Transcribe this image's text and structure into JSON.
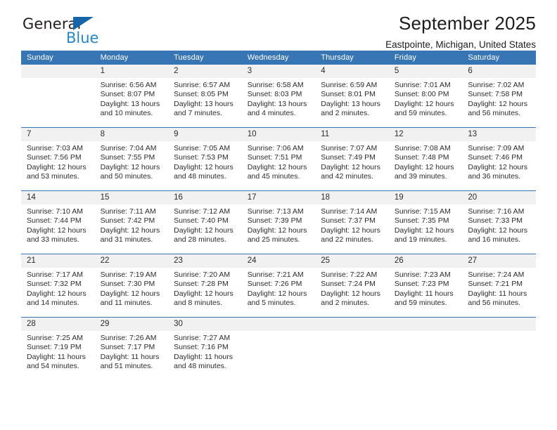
{
  "brand": {
    "name_top": "General",
    "name_bottom": "Blue",
    "triangle_color": "#1565a8",
    "blue_text_color": "#2487cb"
  },
  "header": {
    "title": "September 2025",
    "subtitle": "Eastpointe, Michigan, United States"
  },
  "theme": {
    "header_row_bg": "#3875b5",
    "header_row_text": "#ffffff",
    "daynum_bg": "#f1f1f1",
    "week_divider": "#3875b5",
    "body_text": "#2b2b2b"
  },
  "calendar": {
    "weekday_headers": [
      "Sunday",
      "Monday",
      "Tuesday",
      "Wednesday",
      "Thursday",
      "Friday",
      "Saturday"
    ],
    "weeks": [
      [
        {
          "day": "",
          "sunrise": "",
          "sunset": "",
          "daylight": "",
          "empty": true
        },
        {
          "day": "1",
          "sunrise": "Sunrise: 6:56 AM",
          "sunset": "Sunset: 8:07 PM",
          "daylight": "Daylight: 13 hours and 10 minutes."
        },
        {
          "day": "2",
          "sunrise": "Sunrise: 6:57 AM",
          "sunset": "Sunset: 8:05 PM",
          "daylight": "Daylight: 13 hours and 7 minutes."
        },
        {
          "day": "3",
          "sunrise": "Sunrise: 6:58 AM",
          "sunset": "Sunset: 8:03 PM",
          "daylight": "Daylight: 13 hours and 4 minutes."
        },
        {
          "day": "4",
          "sunrise": "Sunrise: 6:59 AM",
          "sunset": "Sunset: 8:01 PM",
          "daylight": "Daylight: 13 hours and 2 minutes."
        },
        {
          "day": "5",
          "sunrise": "Sunrise: 7:01 AM",
          "sunset": "Sunset: 8:00 PM",
          "daylight": "Daylight: 12 hours and 59 minutes."
        },
        {
          "day": "6",
          "sunrise": "Sunrise: 7:02 AM",
          "sunset": "Sunset: 7:58 PM",
          "daylight": "Daylight: 12 hours and 56 minutes."
        }
      ],
      [
        {
          "day": "7",
          "sunrise": "Sunrise: 7:03 AM",
          "sunset": "Sunset: 7:56 PM",
          "daylight": "Daylight: 12 hours and 53 minutes."
        },
        {
          "day": "8",
          "sunrise": "Sunrise: 7:04 AM",
          "sunset": "Sunset: 7:55 PM",
          "daylight": "Daylight: 12 hours and 50 minutes."
        },
        {
          "day": "9",
          "sunrise": "Sunrise: 7:05 AM",
          "sunset": "Sunset: 7:53 PM",
          "daylight": "Daylight: 12 hours and 48 minutes."
        },
        {
          "day": "10",
          "sunrise": "Sunrise: 7:06 AM",
          "sunset": "Sunset: 7:51 PM",
          "daylight": "Daylight: 12 hours and 45 minutes."
        },
        {
          "day": "11",
          "sunrise": "Sunrise: 7:07 AM",
          "sunset": "Sunset: 7:49 PM",
          "daylight": "Daylight: 12 hours and 42 minutes."
        },
        {
          "day": "12",
          "sunrise": "Sunrise: 7:08 AM",
          "sunset": "Sunset: 7:48 PM",
          "daylight": "Daylight: 12 hours and 39 minutes."
        },
        {
          "day": "13",
          "sunrise": "Sunrise: 7:09 AM",
          "sunset": "Sunset: 7:46 PM",
          "daylight": "Daylight: 12 hours and 36 minutes."
        }
      ],
      [
        {
          "day": "14",
          "sunrise": "Sunrise: 7:10 AM",
          "sunset": "Sunset: 7:44 PM",
          "daylight": "Daylight: 12 hours and 33 minutes."
        },
        {
          "day": "15",
          "sunrise": "Sunrise: 7:11 AM",
          "sunset": "Sunset: 7:42 PM",
          "daylight": "Daylight: 12 hours and 31 minutes."
        },
        {
          "day": "16",
          "sunrise": "Sunrise: 7:12 AM",
          "sunset": "Sunset: 7:40 PM",
          "daylight": "Daylight: 12 hours and 28 minutes."
        },
        {
          "day": "17",
          "sunrise": "Sunrise: 7:13 AM",
          "sunset": "Sunset: 7:39 PM",
          "daylight": "Daylight: 12 hours and 25 minutes."
        },
        {
          "day": "18",
          "sunrise": "Sunrise: 7:14 AM",
          "sunset": "Sunset: 7:37 PM",
          "daylight": "Daylight: 12 hours and 22 minutes."
        },
        {
          "day": "19",
          "sunrise": "Sunrise: 7:15 AM",
          "sunset": "Sunset: 7:35 PM",
          "daylight": "Daylight: 12 hours and 19 minutes."
        },
        {
          "day": "20",
          "sunrise": "Sunrise: 7:16 AM",
          "sunset": "Sunset: 7:33 PM",
          "daylight": "Daylight: 12 hours and 16 minutes."
        }
      ],
      [
        {
          "day": "21",
          "sunrise": "Sunrise: 7:17 AM",
          "sunset": "Sunset: 7:32 PM",
          "daylight": "Daylight: 12 hours and 14 minutes."
        },
        {
          "day": "22",
          "sunrise": "Sunrise: 7:19 AM",
          "sunset": "Sunset: 7:30 PM",
          "daylight": "Daylight: 12 hours and 11 minutes."
        },
        {
          "day": "23",
          "sunrise": "Sunrise: 7:20 AM",
          "sunset": "Sunset: 7:28 PM",
          "daylight": "Daylight: 12 hours and 8 minutes."
        },
        {
          "day": "24",
          "sunrise": "Sunrise: 7:21 AM",
          "sunset": "Sunset: 7:26 PM",
          "daylight": "Daylight: 12 hours and 5 minutes."
        },
        {
          "day": "25",
          "sunrise": "Sunrise: 7:22 AM",
          "sunset": "Sunset: 7:24 PM",
          "daylight": "Daylight: 12 hours and 2 minutes."
        },
        {
          "day": "26",
          "sunrise": "Sunrise: 7:23 AM",
          "sunset": "Sunset: 7:23 PM",
          "daylight": "Daylight: 11 hours and 59 minutes."
        },
        {
          "day": "27",
          "sunrise": "Sunrise: 7:24 AM",
          "sunset": "Sunset: 7:21 PM",
          "daylight": "Daylight: 11 hours and 56 minutes."
        }
      ],
      [
        {
          "day": "28",
          "sunrise": "Sunrise: 7:25 AM",
          "sunset": "Sunset: 7:19 PM",
          "daylight": "Daylight: 11 hours and 54 minutes."
        },
        {
          "day": "29",
          "sunrise": "Sunrise: 7:26 AM",
          "sunset": "Sunset: 7:17 PM",
          "daylight": "Daylight: 11 hours and 51 minutes."
        },
        {
          "day": "30",
          "sunrise": "Sunrise: 7:27 AM",
          "sunset": "Sunset: 7:16 PM",
          "daylight": "Daylight: 11 hours and 48 minutes."
        },
        {
          "day": "",
          "sunrise": "",
          "sunset": "",
          "daylight": "",
          "empty": true
        },
        {
          "day": "",
          "sunrise": "",
          "sunset": "",
          "daylight": "",
          "empty": true
        },
        {
          "day": "",
          "sunrise": "",
          "sunset": "",
          "daylight": "",
          "empty": true
        },
        {
          "day": "",
          "sunrise": "",
          "sunset": "",
          "daylight": "",
          "empty": true
        }
      ]
    ]
  }
}
